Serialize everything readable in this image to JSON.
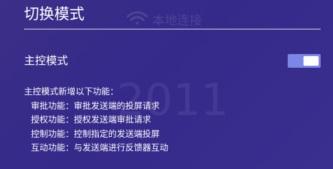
{
  "header": {
    "title": "切换模式"
  },
  "background": {
    "connection_text": "本地连接",
    "watermark_text": "2011"
  },
  "master_mode": {
    "label": "主控模式",
    "enabled": true,
    "accent_color": "#7b87e6"
  },
  "description": {
    "heading": "主控模式新增以下功能：",
    "items": [
      "审批功能：审批发送端的投屏请求",
      "授权功能：授权发送端审批请求",
      "控制功能：控制指定的发送端投屏",
      "互动功能：与发送端进行反馈器互动"
    ]
  }
}
